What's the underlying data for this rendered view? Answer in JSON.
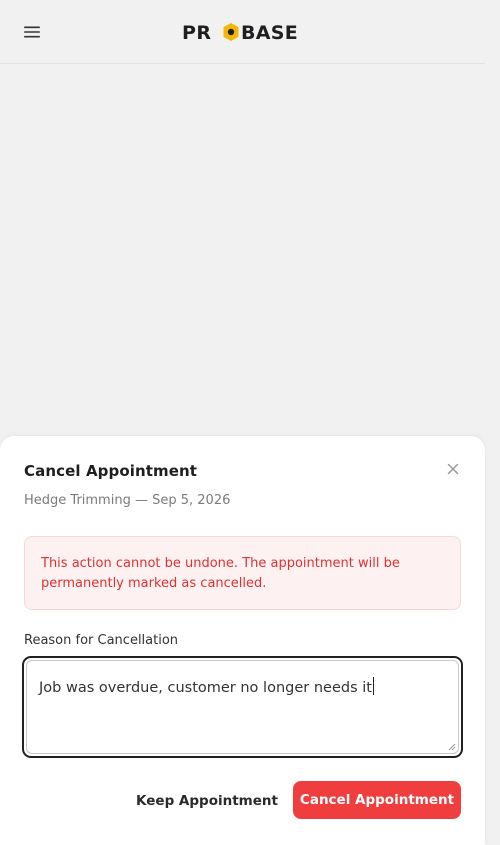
{
  "header": {
    "logo_text": "PROBASE",
    "menu_icon": "hamburger-menu-icon"
  },
  "dialog": {
    "title": "Cancel Appointment",
    "service": "Hedge Trimming",
    "separator": "—",
    "date": "Sep 5, 2026",
    "warning": "This action cannot be undone. The appointment will be permanently marked as cancelled.",
    "reason_label": "Reason for Cancellation",
    "reason_value": "Job was overdue, customer no longer needs it",
    "keep_label": "Keep Appointment",
    "confirm_label": "Cancel Appointment",
    "close_icon": "close-icon"
  },
  "colors": {
    "brand_dark": "#1f1f1f",
    "brand_accent": "#f5b700",
    "danger": "#f03e3e",
    "danger_text": "#e03131",
    "warning_bg": "#fdf1f1"
  }
}
